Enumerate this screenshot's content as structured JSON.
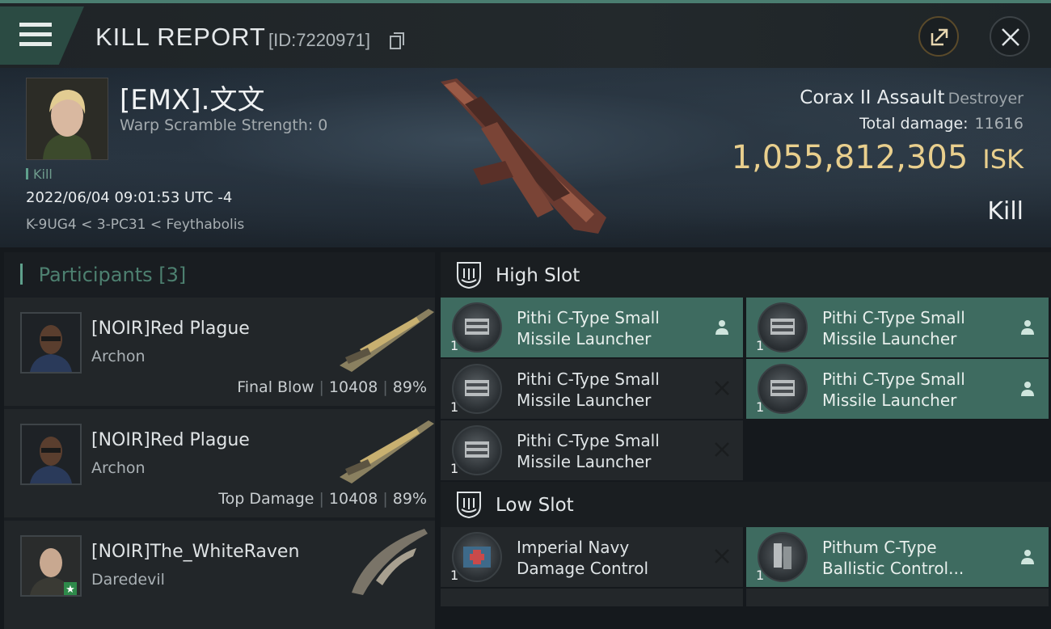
{
  "header": {
    "title": "KILL REPORT",
    "report_id": "[ID:7220971]"
  },
  "victim": {
    "name": "[EMX].文文",
    "warp_scramble": "Warp Scramble Strength: 0",
    "tag": "Kill",
    "datetime": "2022/06/04 09:01:53 UTC -4",
    "location": "K-9UG4 < 3-PC31 < Feythabolis",
    "ship_name": "Corax II Assault",
    "ship_class": "Destroyer",
    "total_damage_label": "Total damage:",
    "total_damage": "11616",
    "isk_value": "1,055,812,305",
    "isk_unit": "ISK",
    "result": "Kill"
  },
  "participants": {
    "label": "Participants",
    "count": "[3]",
    "rows": [
      {
        "name": "[NOIR]Red Plague",
        "ship": "Archon",
        "role": "Final Blow",
        "damage": "10408",
        "percent": "89%"
      },
      {
        "name": "[NOIR]Red Plague",
        "ship": "Archon",
        "role": "Top Damage",
        "damage": "10408",
        "percent": "89%"
      },
      {
        "name": "[NOIR]The_WhiteRaven",
        "ship": "Daredevil"
      }
    ]
  },
  "slots": {
    "high": {
      "title": "High Slot",
      "modules": [
        {
          "line1": "Pithi C-Type Small",
          "line2": "Missile Launcher",
          "qty": "1",
          "state": "fitted"
        },
        {
          "line1": "Pithi C-Type Small",
          "line2": "Missile Launcher",
          "qty": "1",
          "state": "fitted"
        },
        {
          "line1": "Pithi C-Type Small",
          "line2": "Missile Launcher",
          "qty": "1",
          "state": "destroyed"
        },
        {
          "line1": "Pithi C-Type Small",
          "line2": "Missile Launcher",
          "qty": "1",
          "state": "fitted"
        },
        {
          "line1": "Pithi C-Type Small",
          "line2": "Missile Launcher",
          "qty": "1",
          "state": "destroyed"
        }
      ]
    },
    "low": {
      "title": "Low Slot",
      "modules": [
        {
          "line1": "Imperial Navy",
          "line2": "Damage Control",
          "qty": "1",
          "state": "destroyed"
        },
        {
          "line1": "Pithum C-Type",
          "line2": "Ballistic Control...",
          "qty": "1",
          "state": "fitted"
        }
      ]
    }
  },
  "colors": {
    "accent": "#4a7d70",
    "fitted_bg": "#3e6b60",
    "isk_gold": "#e9cf8d"
  }
}
